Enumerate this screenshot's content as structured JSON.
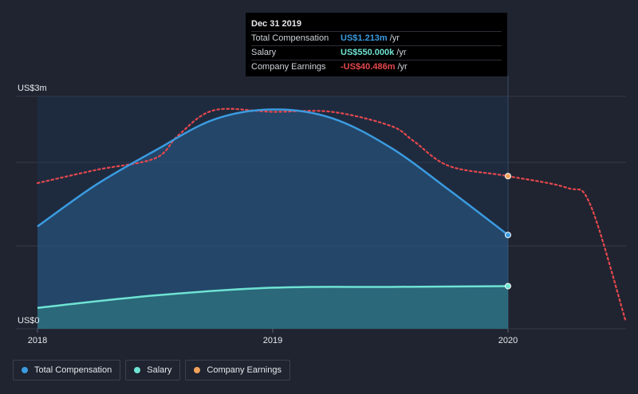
{
  "tooltip": {
    "date": "Dec 31 2019",
    "rows": [
      {
        "name": "Total Compensation",
        "value": "US$1.213m",
        "unit": "/yr",
        "color": "#3b9be0"
      },
      {
        "name": "Salary",
        "value": "US$550.000k",
        "unit": "/yr",
        "color": "#6fe3d3"
      },
      {
        "name": "Company Earnings",
        "value": "-US$40.486m",
        "unit": "/yr",
        "color": "#e5484d"
      }
    ]
  },
  "legend": [
    {
      "label": "Total Compensation",
      "color": "#3b9be0"
    },
    {
      "label": "Salary",
      "color": "#6fe3d3"
    },
    {
      "label": "Company Earnings",
      "color": "#f0a25a"
    }
  ],
  "chart_data": {
    "type": "line",
    "y_tick_labels": [
      "US$3m",
      "US$0"
    ],
    "x_ticks": [
      "2018",
      "2019",
      "2020"
    ],
    "ylim": [
      0,
      3.0
    ],
    "xlim": [
      2018.0,
      2020.5
    ],
    "grid": true,
    "legend_position": "bottom-left",
    "series": [
      {
        "name": "Total Compensation",
        "color": "#3b9be0",
        "unit": "US$m",
        "x": [
          2018.0,
          2018.25,
          2018.5,
          2018.75,
          2019.0,
          2019.25,
          2019.5,
          2019.75,
          2020.0
        ],
        "y": [
          1.32,
          1.86,
          2.3,
          2.7,
          2.83,
          2.72,
          2.34,
          1.79,
          1.21
        ]
      },
      {
        "name": "Salary",
        "color": "#6fe3d3",
        "unit": "US$m",
        "x": [
          2018.0,
          2018.5,
          2019.0,
          2019.5,
          2020.0
        ],
        "y": [
          0.27,
          0.43,
          0.53,
          0.54,
          0.55
        ]
      },
      {
        "name": "Company Earnings",
        "color": "#e5484d",
        "marker_color": "#f0a25a",
        "unit": "US$m",
        "x": [
          2018.0,
          2018.25,
          2018.5,
          2018.6,
          2018.75,
          2019.0,
          2019.25,
          2019.5,
          2019.6,
          2019.75,
          2020.0,
          2020.25,
          2020.35,
          2020.5
        ],
        "y_relative_label": "earnings (same plotting scale as rendered)",
        "y": [
          1.88,
          2.05,
          2.2,
          2.5,
          2.82,
          2.8,
          2.8,
          2.62,
          2.42,
          2.1,
          1.97,
          1.82,
          1.6,
          0.1
        ]
      }
    ]
  }
}
